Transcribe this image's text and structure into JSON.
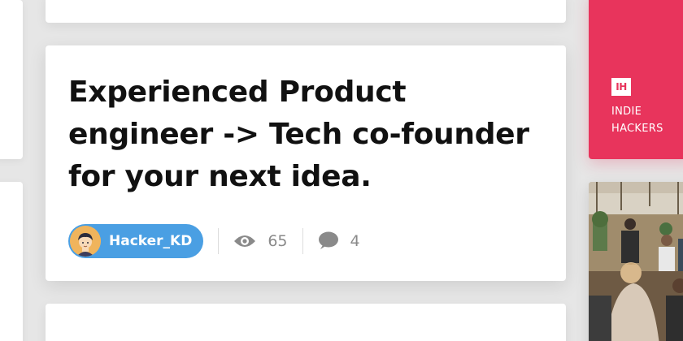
{
  "post": {
    "title": "Experienced Product engineer -> Tech co-founder for your next idea.",
    "author": "Hacker_KD",
    "views": "65",
    "comments": "4"
  },
  "sidebar_ad": {
    "logo_text": "IH",
    "line1": "INDIE",
    "line2": "HACKERS",
    "color": "#e8345c"
  },
  "colors": {
    "author_pill": "#4a9fe3",
    "background": "#e6e6e6",
    "stat_gray": "#8a8a8a"
  },
  "icons": {
    "views": "eye-icon",
    "comments": "comment-bubble-icon",
    "avatar": "user-avatar-illustration"
  }
}
